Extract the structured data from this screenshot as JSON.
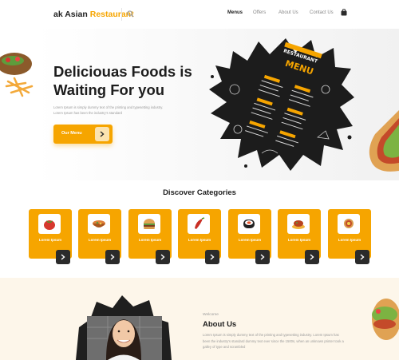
{
  "header": {
    "logo_text": "ak Asian",
    "logo_accent": "Restaurant",
    "nav": [
      {
        "label": "Menus",
        "active": true
      },
      {
        "label": "Offers",
        "active": false
      },
      {
        "label": "About Us",
        "active": false
      },
      {
        "label": "Contact Us",
        "active": false
      }
    ]
  },
  "hero": {
    "title_line1": "Deliciouas Foods is",
    "title_line2": "Waiting For you",
    "description": "Lorem Ipsum is simply dummy text of the printing and typesetting industry. Lorem Ipsum has been the industry's standard",
    "button_label": "Our Menu",
    "board_heading_line1": "RESTAURANT",
    "board_heading_line2": "MENU"
  },
  "categories": {
    "title": "Discover Categories",
    "items": [
      {
        "label": "Lorem Ipsum",
        "icon": "strawberry-icon"
      },
      {
        "label": "Lorem Ipsum",
        "icon": "soup-bowl-icon"
      },
      {
        "label": "Lorem Ipsum",
        "icon": "burger-icon"
      },
      {
        "label": "Lorem Ipsum",
        "icon": "chili-icon"
      },
      {
        "label": "Lorem Ipsum",
        "icon": "sushi-icon"
      },
      {
        "label": "Lorem Ipsum",
        "icon": "bbq-icon"
      },
      {
        "label": "Lorem Ipsum",
        "icon": "sandwich-icon"
      }
    ]
  },
  "about": {
    "kicker": "Welcome",
    "title": "About Us",
    "text": "Lorem Ipsum is simply dummy text of the printing and typesetting industry. Lorem Ipsum has been the industry's standard dummy text ever since the 1500s, when an unknown printer took a galley of type and scrambled"
  },
  "colors": {
    "accent": "#f6a500",
    "dark": "#2b2b2b",
    "about_bg": "#fdf6ea"
  }
}
